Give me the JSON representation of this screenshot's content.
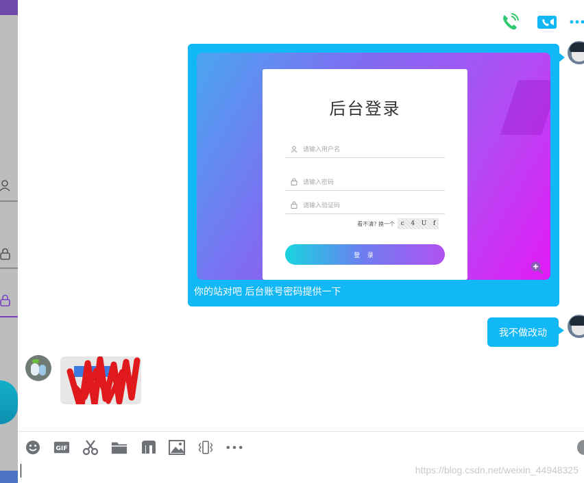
{
  "header": {
    "icons": [
      "voice-call-icon",
      "video-call-icon",
      "more-icon"
    ]
  },
  "messages": {
    "image_message": {
      "screenshot": {
        "title": "后台登录",
        "username_placeholder": "请输入用户名",
        "password_placeholder": "请输入密码",
        "captcha_placeholder": "请输入验证码",
        "captcha_hint": "看不清? 换一个",
        "captcha_chars": [
          "c",
          "4",
          "U",
          "f"
        ],
        "login_button": "登 录"
      },
      "caption": "你的站对吧 后台账号密码提供一下"
    },
    "text_message": {
      "text": "我不做改动"
    }
  },
  "toolbar": {
    "icons": [
      "emoji-icon",
      "gif-icon",
      "scissors-icon",
      "folder-icon",
      "music-icon",
      "image-icon",
      "shake-icon",
      "more-icon"
    ]
  },
  "input": {
    "watermark": "https://blog.csdn.net/weixin_44948325"
  },
  "colors": {
    "bubble_blue": "#12b7f5",
    "bubble_gray": "#e7e7e7",
    "call_green": "#2fc870",
    "icon_gray": "#6e7176"
  }
}
